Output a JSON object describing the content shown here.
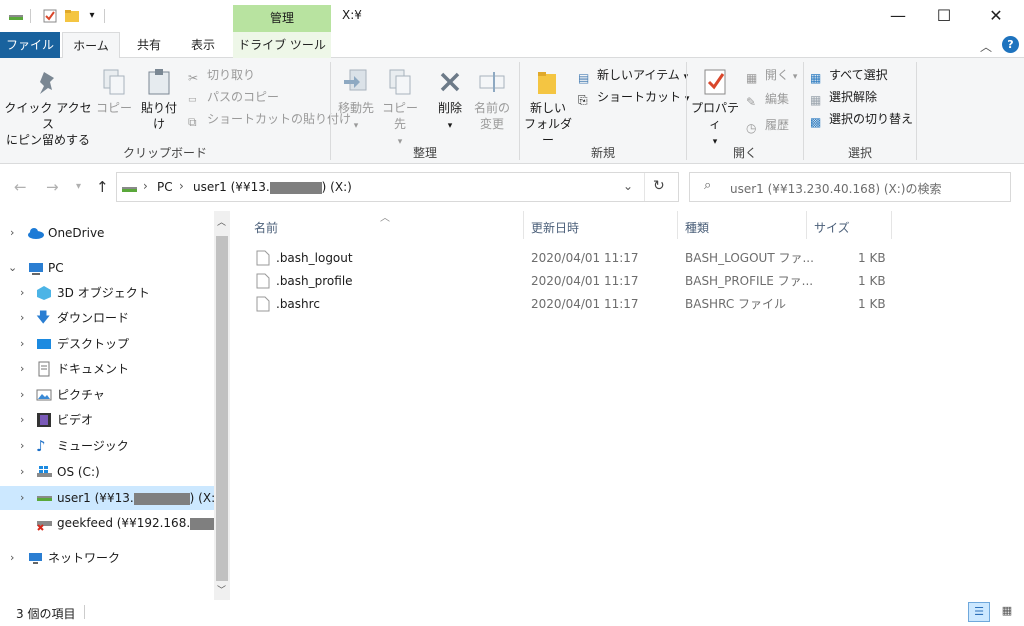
{
  "window": {
    "title": "X:¥",
    "context_tab_header": "管理"
  },
  "ribbon_tabs": [
    "ファイル",
    "ホーム",
    "共有",
    "表示",
    "ドライブ ツール"
  ],
  "ribbon": {
    "clipboard": {
      "group": "クリップボード",
      "pin_line1": "クイック アクセス",
      "pin_line2": "にピン留めする",
      "copy": "コピー",
      "paste": "貼り付け",
      "cut": "切り取り",
      "copy_path": "パスのコピー",
      "paste_shortcut": "ショートカットの貼り付け"
    },
    "organize": {
      "group": "整理",
      "move_to": "移動先",
      "copy_to": "コピー先",
      "delete": "削除",
      "rename_line1": "名前の",
      "rename_line2": "変更"
    },
    "new": {
      "group": "新規",
      "folder_line1": "新しい",
      "folder_line2": "フォルダー",
      "new_item": "新しいアイテム",
      "shortcut": "ショートカット"
    },
    "open": {
      "group": "開く",
      "properties": "プロパティ",
      "open": "開く",
      "edit": "編集",
      "history": "履歴"
    },
    "select": {
      "group": "選択",
      "select_all": "すべて選択",
      "select_none": "選択解除",
      "invert": "選択の切り替え"
    }
  },
  "address": {
    "root": "PC",
    "location": "user1 (¥¥13.",
    "location_suffix": ") (X:)"
  },
  "search": {
    "placeholder": "user1 (¥¥13.230.40.168) (X:)の検索"
  },
  "nav": {
    "onedrive": "OneDrive",
    "pc": "PC",
    "objects3d": "3D オブジェクト",
    "downloads": "ダウンロード",
    "desktop": "デスクトップ",
    "documents": "ドキュメント",
    "pictures": "ピクチャ",
    "videos": "ビデオ",
    "music": "ミュージック",
    "os": "OS (C:)",
    "user1": "user1 (¥¥13.",
    "user1_suffix": ") (X:)",
    "geekfeed": "geekfeed (¥¥192.168.",
    "network": "ネットワーク"
  },
  "columns": {
    "name": "名前",
    "modified": "更新日時",
    "type": "種類",
    "size": "サイズ"
  },
  "files": [
    {
      "name": ".bash_logout",
      "modified": "2020/04/01 11:17",
      "type": "BASH_LOGOUT ファ...",
      "size": "1 KB"
    },
    {
      "name": ".bash_profile",
      "modified": "2020/04/01 11:17",
      "type": "BASH_PROFILE ファ...",
      "size": "1 KB"
    },
    {
      "name": ".bashrc",
      "modified": "2020/04/01 11:17",
      "type": "BASHRC ファイル",
      "size": "1 KB"
    }
  ],
  "status": {
    "item_count": "3 個の項目"
  },
  "colors": {
    "file_tab": "#19629e",
    "context_tab": "#b8e3a0",
    "selection": "#cce8ff",
    "help": "#1e73be"
  }
}
